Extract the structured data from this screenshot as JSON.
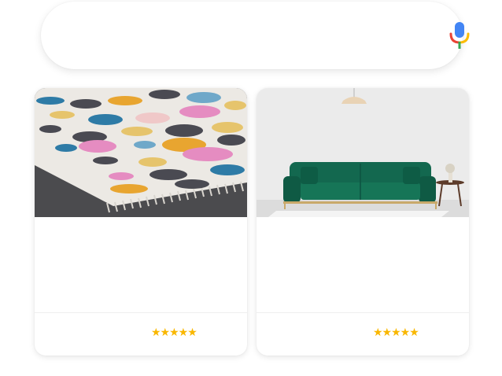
{
  "search": {
    "mic_icon": "microphone-icon",
    "mic_colors": [
      "#4285F4",
      "#EA4335",
      "#FBBC05",
      "#34A853"
    ]
  },
  "products": [
    {
      "image": "patterned-rug-image",
      "title": "",
      "price": "",
      "rating": 5,
      "rating_stars": "★★★★★"
    },
    {
      "image": "green-sofa-image",
      "title": "",
      "price": "",
      "rating": 5,
      "rating_stars": "★★★★★"
    }
  ],
  "colors": {
    "star": "#F9B700",
    "sofa": "#13684F",
    "rug_dots": [
      "#E58CC1",
      "#E8A530",
      "#2E7BA6",
      "#4A4A52",
      "#F0C8C8",
      "#E6C46C",
      "#6FA8C9"
    ]
  }
}
